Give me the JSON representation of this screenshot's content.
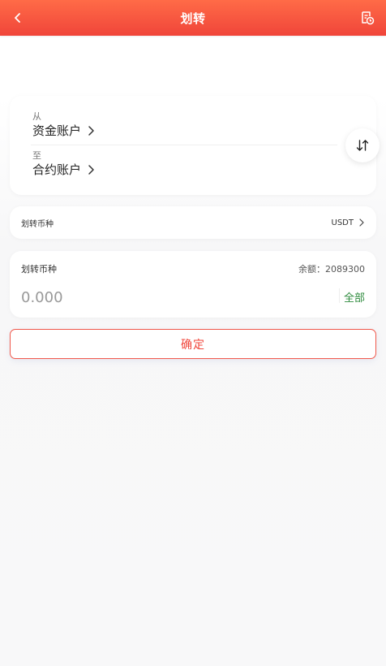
{
  "header": {
    "title": "划转"
  },
  "accounts": {
    "from_label": "从",
    "from_value": "资金账户",
    "to_label": "至",
    "to_value": "合约账户"
  },
  "coin": {
    "label": "划转币种",
    "value": "USDT"
  },
  "amount": {
    "label": "划转币种",
    "balance": "余额：2089300",
    "placeholder": "0.000",
    "all_label": "全部"
  },
  "confirm_label": "确定",
  "colors": {
    "header_start": "#ff6b47",
    "header_end": "#f0453a",
    "accent_red": "#f0453a",
    "accent_green": "#2e8b3d"
  },
  "icons": {
    "back": "chevron-left-icon",
    "records": "record-clock-icon",
    "swap": "swap-arrows-icon",
    "chevron": "chevron-right-icon"
  }
}
